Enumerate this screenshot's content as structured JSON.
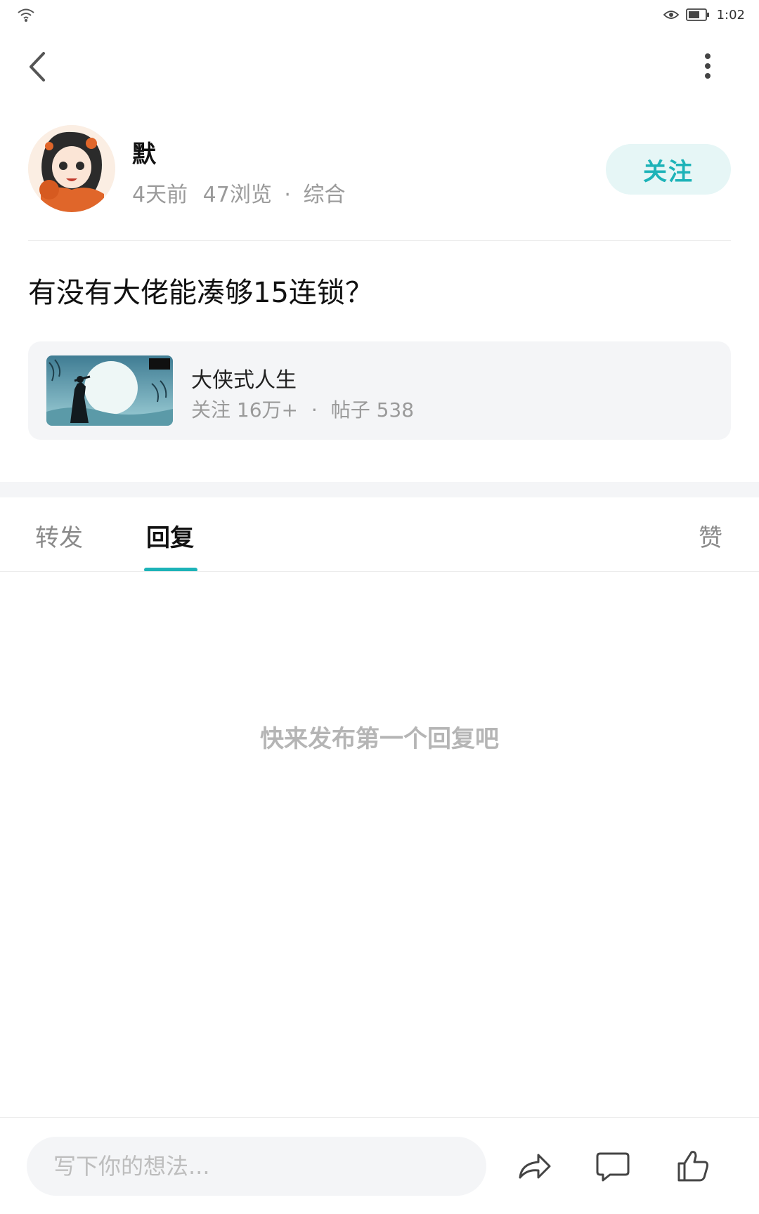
{
  "status_bar": {
    "time": "1:02",
    "icons": [
      "wifi-icon",
      "eye-icon",
      "battery-icon"
    ]
  },
  "nav": {
    "back_icon": "chevron-left-icon",
    "more_icon": "more-vertical-icon"
  },
  "author": {
    "name": "默",
    "time_ago": "4天前",
    "views": "47浏览",
    "separator": "·",
    "category": "综合",
    "follow_label": "关注"
  },
  "post": {
    "title": "有没有大佬能凑够15连锁？"
  },
  "game_card": {
    "name": "大侠式人生",
    "followers": "关注 16万+",
    "separator": "·",
    "posts": "帖子 538"
  },
  "tabs": {
    "repost": "转发",
    "reply": "回复",
    "like": "赞",
    "active": "回复"
  },
  "empty_hint": "快来发布第一个回复吧",
  "bottom_bar": {
    "input_placeholder": "写下你的想法...",
    "icons": [
      "share-icon",
      "comment-icon",
      "thumbs-up-icon"
    ]
  },
  "colors": {
    "accent": "#1db3b8",
    "follow_bg": "#e6f6f6",
    "muted_text": "#9a9a9a",
    "card_bg": "#f4f5f7"
  }
}
